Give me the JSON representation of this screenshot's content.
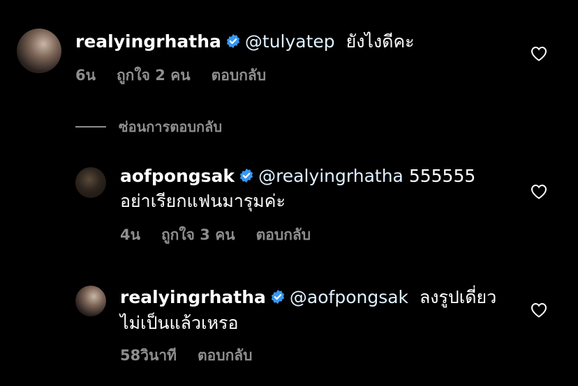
{
  "colors": {
    "background": "#000000",
    "text": "#ffffff",
    "muted": "#8e8e8e",
    "verified": "#3897f0",
    "mention": "#e0f1ff"
  },
  "comments": [
    {
      "username": "realyingrhatha",
      "mention": "@tulyatep",
      "text_line1": "ยังไงดีคะ",
      "text_line2": "",
      "time": "6น",
      "likes": "ถูกใจ 2 คน",
      "reply": "ตอบกลับ",
      "avatar_icon": "profile-photo-avatar"
    },
    {
      "username": "aofpongsak",
      "mention": "@realyingrhatha",
      "text_line1": "555555",
      "text_line2": "อย่าเรียกแฟนมารุมค่ะ",
      "time": "4น",
      "likes": "ถูกใจ 3 คน",
      "reply": "ตอบกลับ",
      "avatar_icon": "profile-photo-avatar"
    },
    {
      "username": "realyingrhatha",
      "mention": "@aofpongsak",
      "text_line1": "ลงรูปเดี่ยว",
      "text_line2": "ไม่เป็นแล้วเหรอ",
      "time": "58วินาที",
      "likes": "",
      "reply": "ตอบกลับ",
      "avatar_icon": "profile-photo-avatar"
    }
  ],
  "hide_replies": "ซ่อนการตอบกลับ",
  "icons": {
    "verified": "verified-badge-icon",
    "like": "heart-outline-icon"
  }
}
